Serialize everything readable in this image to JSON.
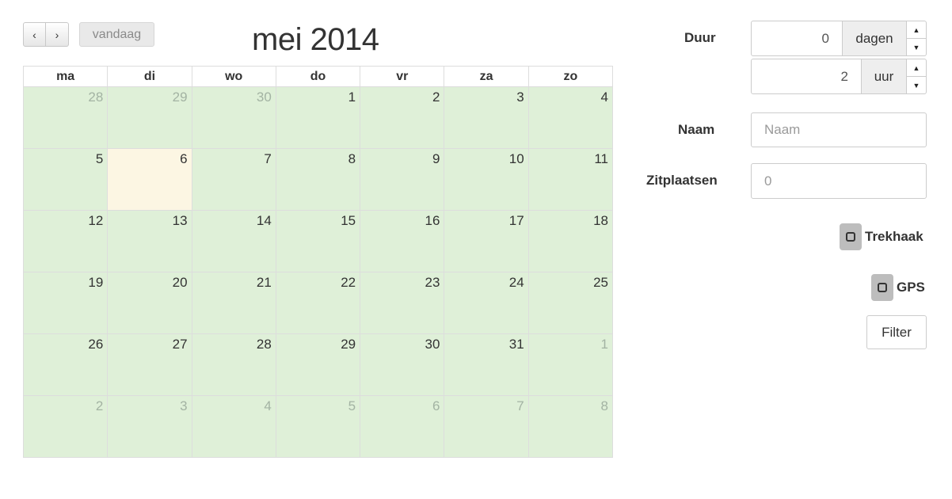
{
  "calendar": {
    "prev_label": "‹",
    "next_label": "›",
    "today_label": "vandaag",
    "title": "mei 2014",
    "weekdays": [
      "ma",
      "di",
      "wo",
      "do",
      "vr",
      "za",
      "zo"
    ],
    "weeks": [
      [
        {
          "d": "28",
          "other": true
        },
        {
          "d": "29",
          "other": true
        },
        {
          "d": "30",
          "other": true
        },
        {
          "d": "1"
        },
        {
          "d": "2"
        },
        {
          "d": "3"
        },
        {
          "d": "4"
        }
      ],
      [
        {
          "d": "5"
        },
        {
          "d": "6",
          "today": true
        },
        {
          "d": "7"
        },
        {
          "d": "8"
        },
        {
          "d": "9"
        },
        {
          "d": "10"
        },
        {
          "d": "11"
        }
      ],
      [
        {
          "d": "12"
        },
        {
          "d": "13"
        },
        {
          "d": "14"
        },
        {
          "d": "15"
        },
        {
          "d": "16"
        },
        {
          "d": "17"
        },
        {
          "d": "18"
        }
      ],
      [
        {
          "d": "19"
        },
        {
          "d": "20"
        },
        {
          "d": "21"
        },
        {
          "d": "22"
        },
        {
          "d": "23"
        },
        {
          "d": "24"
        },
        {
          "d": "25"
        }
      ],
      [
        {
          "d": "26"
        },
        {
          "d": "27"
        },
        {
          "d": "28"
        },
        {
          "d": "29"
        },
        {
          "d": "30"
        },
        {
          "d": "31"
        },
        {
          "d": "1",
          "other": true
        }
      ],
      [
        {
          "d": "2",
          "other": true
        },
        {
          "d": "3",
          "other": true
        },
        {
          "d": "4",
          "other": true
        },
        {
          "d": "5",
          "other": true
        },
        {
          "d": "6",
          "other": true
        },
        {
          "d": "7",
          "other": true
        },
        {
          "d": "8",
          "other": true
        }
      ]
    ],
    "colors": {
      "available": "#dff0d8",
      "today": "#fcf6e3",
      "border": "#dddddd"
    }
  },
  "form": {
    "duration_label": "Duur",
    "days_value": "0",
    "days_unit": "dagen",
    "hours_value": "2",
    "hours_unit": "uur",
    "name_label": "Naam",
    "name_placeholder": "Naam",
    "seats_label": "Zitplaatsen",
    "seats_placeholder": "0",
    "towbar_label": "Trekhaak",
    "gps_label": "GPS",
    "filter_label": "Filter",
    "spin_up_icon": "▲",
    "spin_down_icon": "▼"
  }
}
